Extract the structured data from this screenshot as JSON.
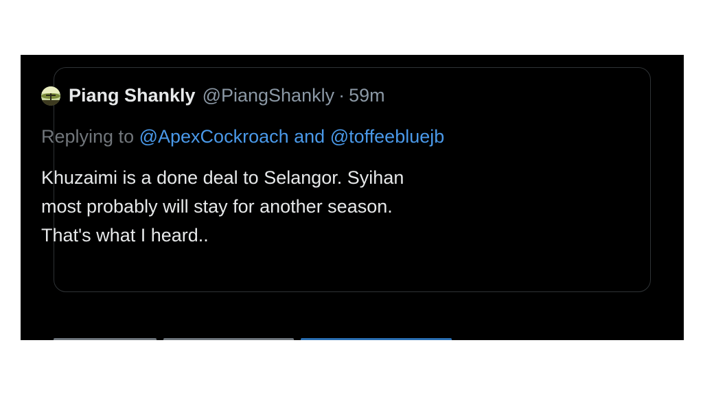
{
  "tweet": {
    "display_name": "Piang Shankly",
    "handle": "@PiangShankly",
    "separator": "·",
    "time": "59m",
    "reply": {
      "prefix": "Replying to",
      "mention_1": "@ApexCockroach",
      "conjunction": "and",
      "mention_2": "@toffeebluejb"
    },
    "body_lines": [
      "Khuzaimi is a done deal to Selangor.  Syihan",
      "most probably will stay for another season.",
      "That's what I heard.."
    ]
  },
  "colors": {
    "background": "#000000",
    "primary_text": "#e7e9ea",
    "secondary_text": "#8b98a5",
    "link": "#4a99e9",
    "card_border": "#2f3336"
  },
  "icons": {
    "avatar": "profile-avatar"
  }
}
